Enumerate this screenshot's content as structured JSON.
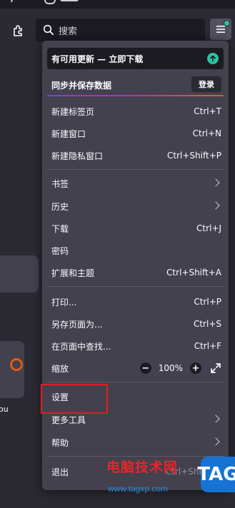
{
  "toolbar": {
    "search_placeholder": "搜索"
  },
  "background": {
    "tile_label": "ou"
  },
  "menu": {
    "update_banner": "有可用更新 — 立即下载",
    "sync_label": "同步并保存数据",
    "signin_button": "登录",
    "items": {
      "new_tab": {
        "label": "新建标签页",
        "shortcut": "Ctrl+T"
      },
      "new_window": {
        "label": "新建窗口",
        "shortcut": "Ctrl+N"
      },
      "new_private": {
        "label": "新建隐私窗口",
        "shortcut": "Ctrl+Shift+P"
      },
      "bookmarks": {
        "label": "书签"
      },
      "history": {
        "label": "历史"
      },
      "downloads": {
        "label": "下载",
        "shortcut": "Ctrl+J"
      },
      "passwords": {
        "label": "密码"
      },
      "addons": {
        "label": "扩展和主题",
        "shortcut": "Ctrl+Shift+A"
      },
      "print": {
        "label": "打印...",
        "shortcut": "Ctrl+P"
      },
      "save_page": {
        "label": "另存页面为...",
        "shortcut": "Ctrl+S"
      },
      "find": {
        "label": "在页面中查找...",
        "shortcut": "Ctrl+F"
      },
      "zoom": {
        "label": "缩放",
        "value": "100%",
        "minus": "−",
        "plus": "+"
      },
      "settings": {
        "label": "设置"
      },
      "more_tools": {
        "label": "更多工具"
      },
      "help": {
        "label": "帮助"
      },
      "quit": {
        "label": "退出",
        "shortcut": "Ctrl+Shift+Q"
      }
    }
  },
  "watermark": {
    "title": "电脑技术网",
    "url": "www.tagxp.com",
    "logo": "TAG"
  },
  "colors": {
    "accent_green": "#2ac3a2",
    "highlight_red": "#e02020",
    "panel_bg": "#42414d"
  }
}
